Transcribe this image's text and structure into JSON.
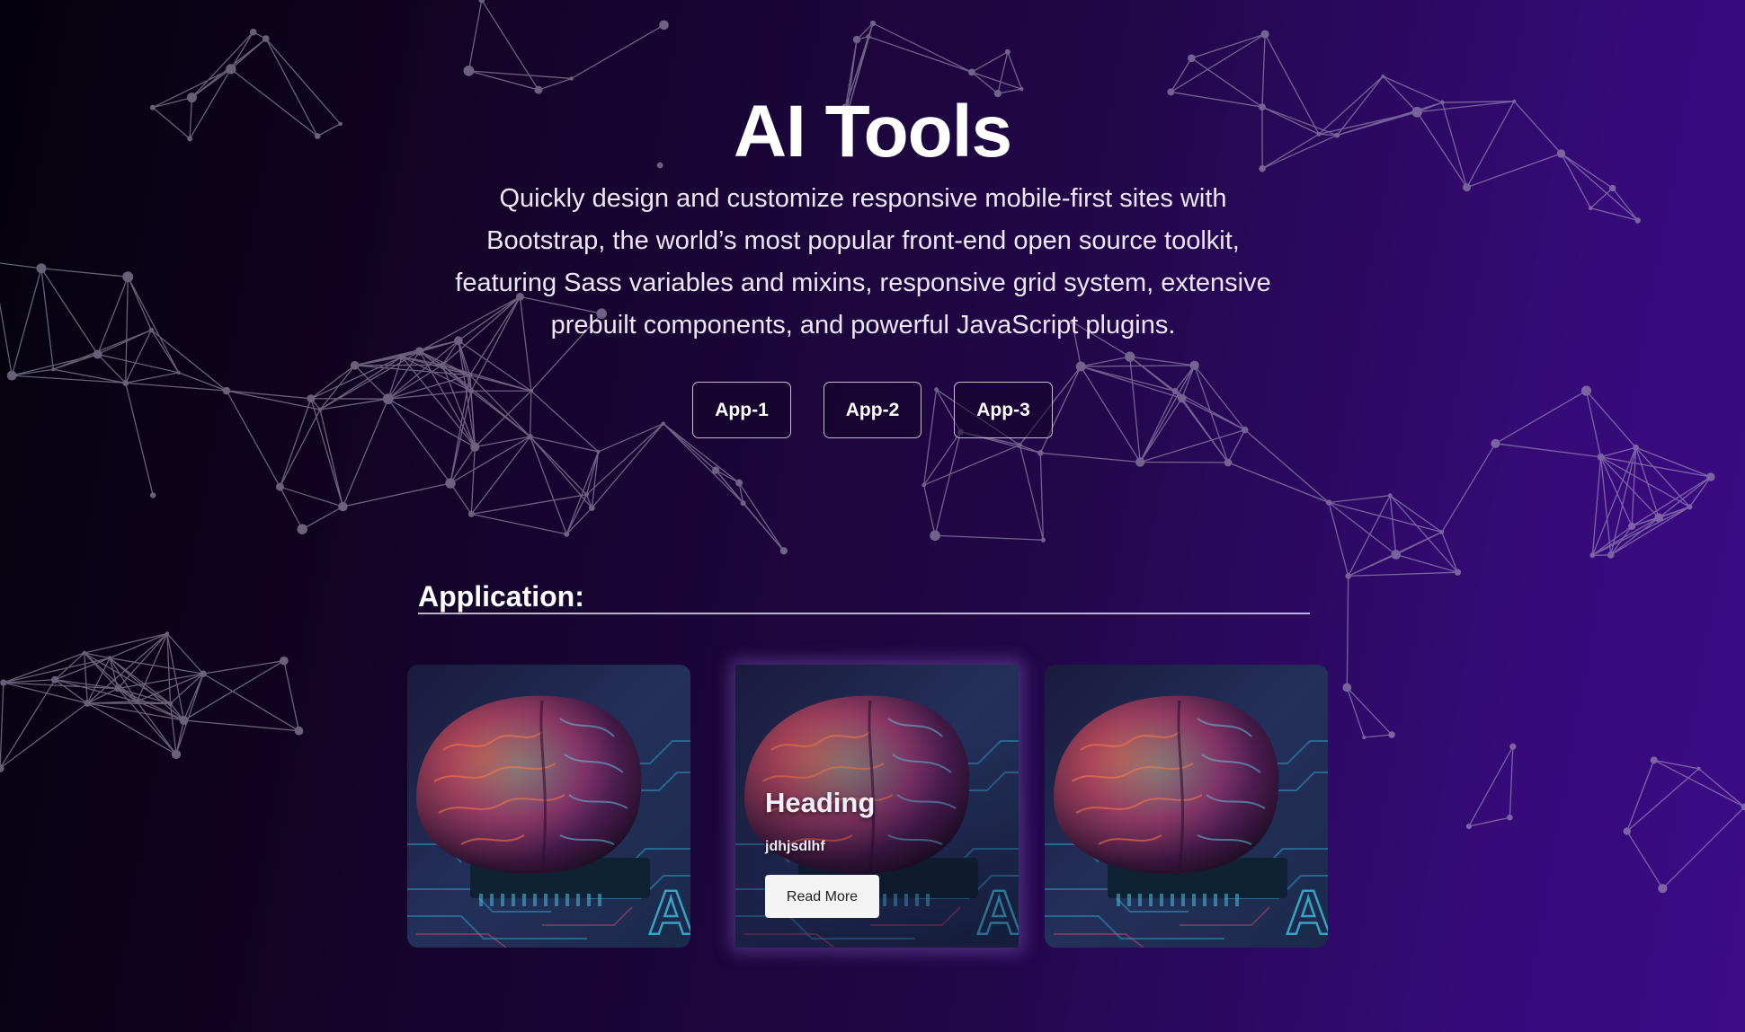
{
  "hero": {
    "title": "AI Tools",
    "description": "Quickly design and customize responsive mobile-first sites with Bootstrap, the world’s most popular front-end open source toolkit, featuring Sass variables and mixins, responsive grid system, extensive prebuilt components, and powerful JavaScript plugins.",
    "buttons": [
      {
        "label": "App-1"
      },
      {
        "label": "App-2"
      },
      {
        "label": "App-3"
      }
    ]
  },
  "application": {
    "heading": "Application:",
    "cards": [
      {
        "image": "brain-chip-image"
      },
      {
        "image": "brain-chip-image",
        "heading": "Heading",
        "text": "jdhjsdlhf",
        "button_label": "Read More"
      },
      {
        "image": "brain-chip-image"
      }
    ]
  },
  "colors": {
    "background_start": "#04010a",
    "background_end": "#3c0b86",
    "network_lines": "#b6aec6",
    "button_border": "#ffffff",
    "read_more_bg": "#f4f4f4"
  }
}
